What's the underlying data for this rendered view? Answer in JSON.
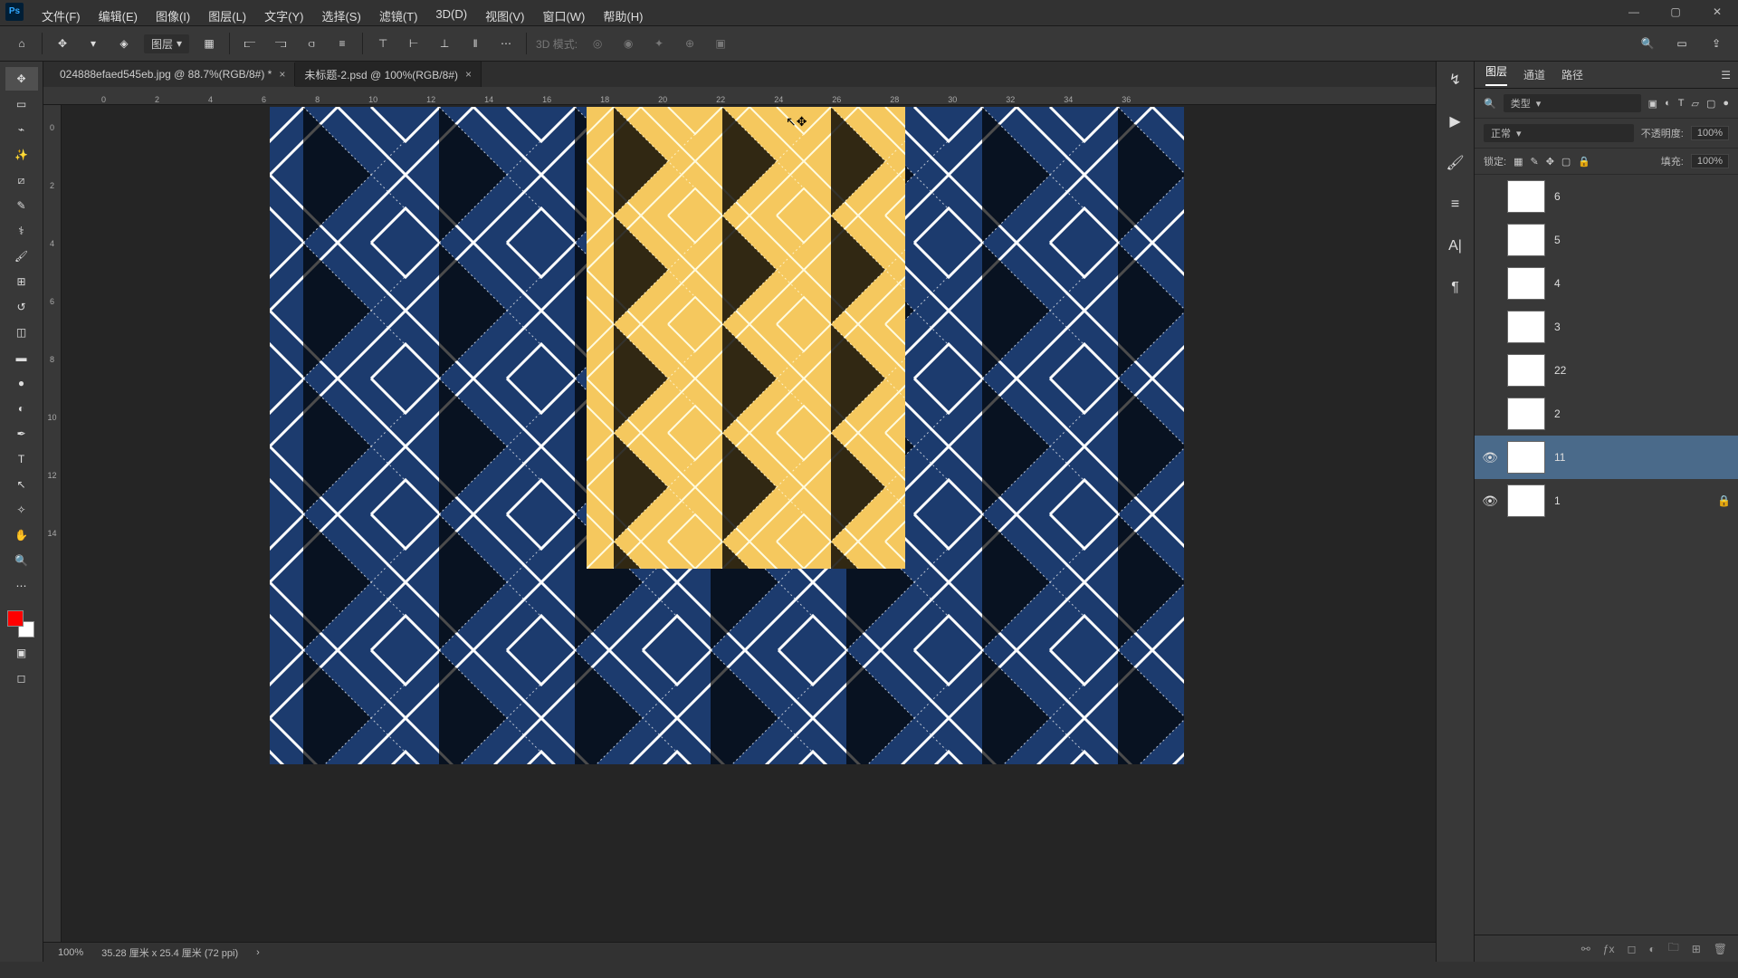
{
  "app": {
    "logo": "Ps"
  },
  "menus": [
    "文件(F)",
    "编辑(E)",
    "图像(I)",
    "图层(L)",
    "文字(Y)",
    "选择(S)",
    "滤镜(T)",
    "3D(D)",
    "视图(V)",
    "窗口(W)",
    "帮助(H)"
  ],
  "options": {
    "layer_label": "图层",
    "threed_label": "3D 模式:"
  },
  "tabs": [
    {
      "title": "024888efaed545eb.jpg @ 88.7%(RGB/8#) *",
      "active": false
    },
    {
      "title": "未标题-2.psd @ 100%(RGB/8#)",
      "active": true
    }
  ],
  "ruler_h": [
    "0",
    "2",
    "4",
    "6",
    "8",
    "10",
    "12",
    "14",
    "16",
    "18",
    "20",
    "22",
    "24",
    "26",
    "28",
    "30",
    "32",
    "34",
    "36"
  ],
  "ruler_v": [
    "0",
    "2",
    "4",
    "6",
    "8",
    "10",
    "12",
    "14"
  ],
  "status": {
    "zoom": "100%",
    "doc_info": "35.28 厘米 x 25.4 厘米 (72 ppi)"
  },
  "layerspanel": {
    "tabs": [
      "图层",
      "通道",
      "路径"
    ],
    "filter_label": "类型",
    "blend_mode": "正常",
    "opacity_label": "不透明度:",
    "opacity_value": "100%",
    "lock_label": "锁定:",
    "fill_label": "填充:",
    "fill_value": "100%"
  },
  "layers": [
    {
      "name": "6",
      "thumb_class": "thumb-red",
      "visible": false,
      "locked": false
    },
    {
      "name": "5",
      "thumb_class": "thumb-green",
      "visible": false,
      "locked": false
    },
    {
      "name": "4",
      "thumb_class": "thumb-white",
      "visible": false,
      "locked": false
    },
    {
      "name": "3",
      "thumb_class": "thumb-beige",
      "visible": false,
      "locked": false
    },
    {
      "name": "22",
      "thumb_class": "thumb-gray",
      "visible": false,
      "locked": false
    },
    {
      "name": "2",
      "thumb_class": "thumb-teal",
      "visible": false,
      "locked": false
    },
    {
      "name": "11",
      "thumb_class": "thumb-ylw",
      "visible": true,
      "locked": false,
      "selected": true
    },
    {
      "name": "1",
      "thumb_class": "thumb-blue",
      "visible": true,
      "locked": true
    }
  ],
  "window_controls": [
    "—",
    "▢",
    "✕"
  ]
}
